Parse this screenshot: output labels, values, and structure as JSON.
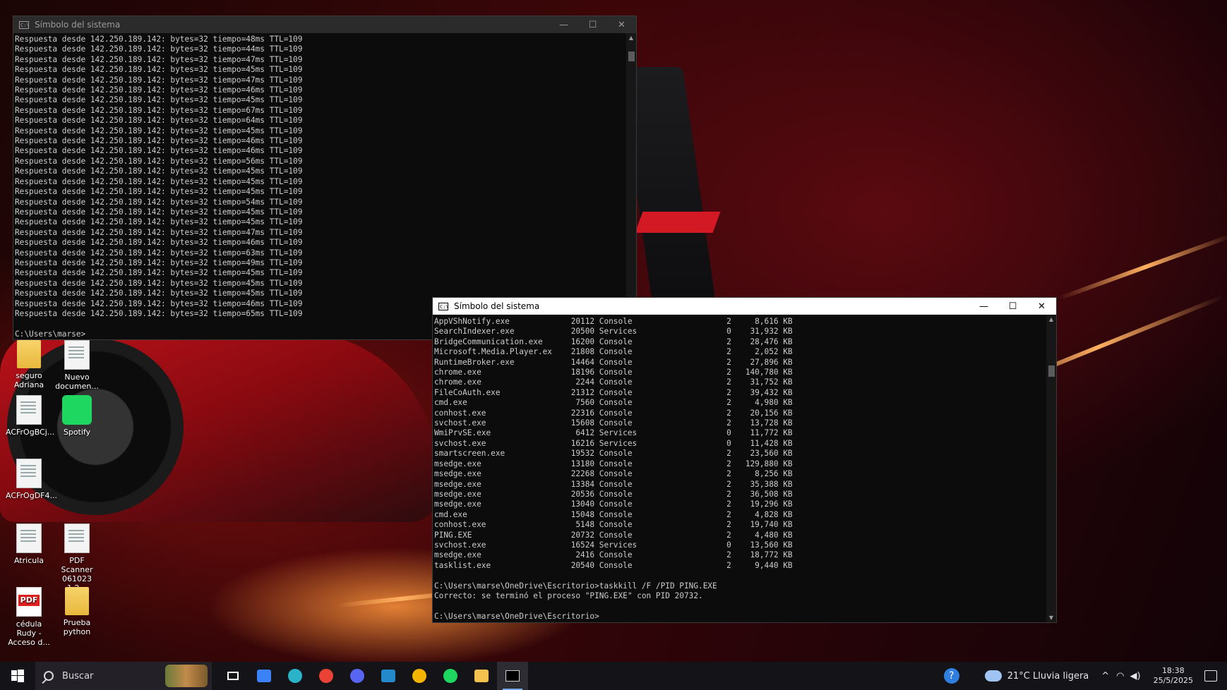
{
  "wallpaper": {
    "accent": "#c2121b"
  },
  "desktop_icons": [
    {
      "label": "seguro Adriana",
      "type": "folder",
      "icon": "folder-icon"
    },
    {
      "label": "Nuevo documen...",
      "type": "doc",
      "icon": "document-icon"
    },
    {
      "label": "ACFrOgBCj...",
      "type": "doc",
      "icon": "edge-document-icon"
    },
    {
      "label": "Spotify",
      "type": "spotify",
      "icon": "spotify-icon"
    },
    {
      "label": "ACFrOgDF4...",
      "type": "doc",
      "icon": "edge-document-icon"
    },
    {
      "label": "Atricula",
      "type": "doc",
      "icon": "edge-document-icon"
    },
    {
      "label": "PDF Scanner 061023 1.2...",
      "type": "doc",
      "icon": "edge-document-icon"
    },
    {
      "label": "cédula Rudy - Acceso d...",
      "type": "pdf",
      "icon": "pdf-icon"
    },
    {
      "label": "Prueba python",
      "type": "folder",
      "icon": "folder-icon"
    }
  ],
  "window1": {
    "title": "Símbolo del sistema",
    "title_icon": "C:\\",
    "ping_host": "142.250.189.142",
    "ping_times": [
      "48",
      "44",
      "47",
      "45",
      "47",
      "46",
      "45",
      "67",
      "64",
      "45",
      "46",
      "46",
      "56",
      "45",
      "45",
      "45",
      "54",
      "45",
      "45",
      "47",
      "46",
      "63",
      "49",
      "45",
      "45",
      "45",
      "46",
      "65"
    ],
    "ping_prefix": "Respuesta desde ",
    "ping_mid": ": bytes=32 tiempo=",
    "ping_suffix": "ms TTL=109",
    "prompt": "C:\\Users\\marse>",
    "controls": {
      "minimize": "—",
      "maximize": "☐",
      "close": "✕"
    }
  },
  "window2": {
    "title": "Símbolo del sistema",
    "title_icon": "C:\\",
    "tasklist": [
      [
        "AppVShNotify.exe",
        "20112",
        "Console",
        "2",
        "8,616 KB"
      ],
      [
        "SearchIndexer.exe",
        "20500",
        "Services",
        "0",
        "31,932 KB"
      ],
      [
        "BridgeCommunication.exe",
        "16200",
        "Console",
        "2",
        "28,476 KB"
      ],
      [
        "Microsoft.Media.Player.ex",
        "21808",
        "Console",
        "2",
        "2,052 KB"
      ],
      [
        "RuntimeBroker.exe",
        "14464",
        "Console",
        "2",
        "27,896 KB"
      ],
      [
        "chrome.exe",
        "18196",
        "Console",
        "2",
        "140,780 KB"
      ],
      [
        "chrome.exe",
        "2244",
        "Console",
        "2",
        "31,752 KB"
      ],
      [
        "FileCoAuth.exe",
        "21312",
        "Console",
        "2",
        "39,432 KB"
      ],
      [
        "cmd.exe",
        "7560",
        "Console",
        "2",
        "4,980 KB"
      ],
      [
        "conhost.exe",
        "22316",
        "Console",
        "2",
        "20,156 KB"
      ],
      [
        "svchost.exe",
        "15608",
        "Console",
        "2",
        "13,728 KB"
      ],
      [
        "WmiPrvSE.exe",
        "6412",
        "Services",
        "0",
        "11,772 KB"
      ],
      [
        "svchost.exe",
        "16216",
        "Services",
        "0",
        "11,428 KB"
      ],
      [
        "smartscreen.exe",
        "19532",
        "Console",
        "2",
        "23,560 KB"
      ],
      [
        "msedge.exe",
        "13180",
        "Console",
        "2",
        "129,880 KB"
      ],
      [
        "msedge.exe",
        "22268",
        "Console",
        "2",
        "8,256 KB"
      ],
      [
        "msedge.exe",
        "13384",
        "Console",
        "2",
        "35,388 KB"
      ],
      [
        "msedge.exe",
        "20536",
        "Console",
        "2",
        "36,508 KB"
      ],
      [
        "msedge.exe",
        "13040",
        "Console",
        "2",
        "19,296 KB"
      ],
      [
        "cmd.exe",
        "15048",
        "Console",
        "2",
        "4,828 KB"
      ],
      [
        "conhost.exe",
        "5148",
        "Console",
        "2",
        "19,740 KB"
      ],
      [
        "PING.EXE",
        "20732",
        "Console",
        "2",
        "4,480 KB"
      ],
      [
        "svchost.exe",
        "16524",
        "Services",
        "0",
        "13,560 KB"
      ],
      [
        "msedge.exe",
        "2416",
        "Console",
        "2",
        "18,772 KB"
      ],
      [
        "tasklist.exe",
        "20540",
        "Console",
        "2",
        "9,440 KB"
      ]
    ],
    "command_line": "C:\\Users\\marse\\OneDrive\\Escritorio>taskkill /F /PID PING.EXE",
    "result_line": "Correcto: se terminó el proceso \"PING.EXE\" con PID 20732.",
    "prompt": "C:\\Users\\marse\\OneDrive\\Escritorio>",
    "controls": {
      "minimize": "—",
      "maximize": "☐",
      "close": "✕"
    }
  },
  "taskbar": {
    "search_placeholder": "Buscar",
    "apps": [
      {
        "name": "task-view-icon",
        "color": "#ffffff"
      },
      {
        "name": "microsoft-store-icon",
        "color": "#3b82f6"
      },
      {
        "name": "edge-icon",
        "color": "#2bb3c9"
      },
      {
        "name": "chrome-icon",
        "color": "#ea4335"
      },
      {
        "name": "discord-icon",
        "color": "#5865f2"
      },
      {
        "name": "vscode-icon",
        "color": "#2489ca"
      },
      {
        "name": "chrome-profile-icon",
        "color": "#f4b400"
      },
      {
        "name": "spotify-icon",
        "color": "#1ed760"
      },
      {
        "name": "file-explorer-icon",
        "color": "#f2c14e"
      },
      {
        "name": "terminal-icon",
        "color": "#cccccc"
      }
    ],
    "weather": "21°C  Lluvia ligera",
    "time": "18:38",
    "date": "25/5/2025",
    "tray_expand": "^"
  }
}
